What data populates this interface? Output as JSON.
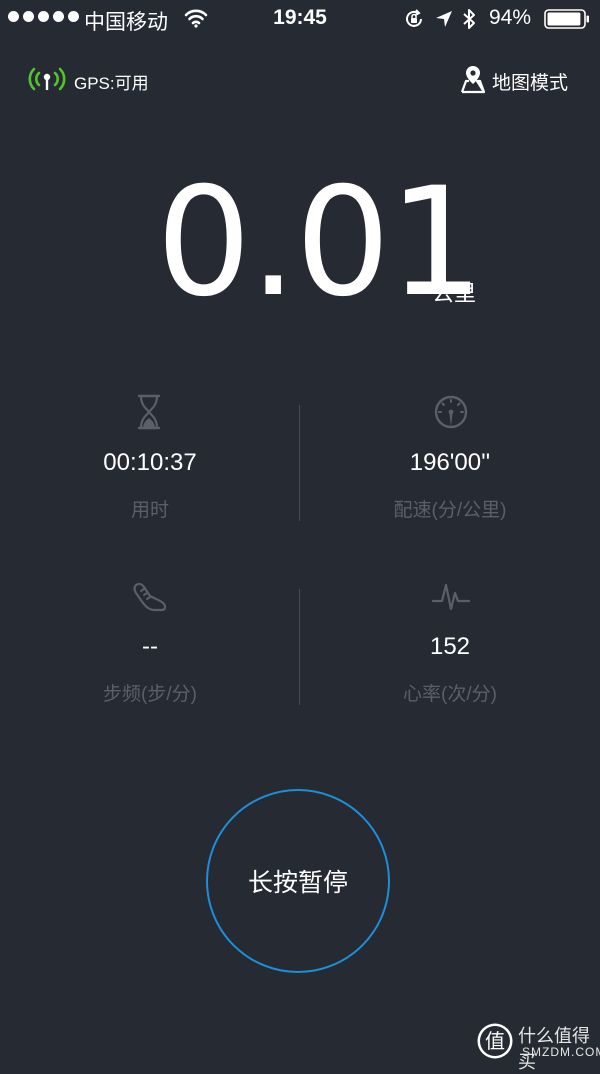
{
  "status_bar": {
    "carrier": "中国移动",
    "time": "19:45",
    "battery_percent": "94%",
    "battery_level": 0.94,
    "signal_bars": 5
  },
  "gps": {
    "label": "GPS:可用",
    "icon": "gps-signal-icon",
    "color": "#54c42e"
  },
  "map_mode": {
    "label": "地图模式",
    "icon": "map-pin-icon"
  },
  "distance": {
    "value": "0.01",
    "unit": "公里"
  },
  "stats": {
    "duration": {
      "value": "00:10:37",
      "label": "用时",
      "icon": "hourglass-icon"
    },
    "pace": {
      "value": "196'00''",
      "label": "配速(分/公里)",
      "icon": "speedometer-icon"
    },
    "cadence": {
      "value": "--",
      "label": "步频(步/分)",
      "icon": "shoe-icon"
    },
    "heart_rate": {
      "value": "152",
      "label": "心率(次/分)",
      "icon": "heartbeat-icon"
    }
  },
  "pause_button": {
    "label": "长按暂停",
    "ring_color": "#1d8fd8"
  },
  "watermark": {
    "logo_char": "值",
    "text": "什么值得买",
    "domain": "SMZDM.COM"
  },
  "colors": {
    "background": "#262a33",
    "muted_text": "#5a5f69"
  }
}
